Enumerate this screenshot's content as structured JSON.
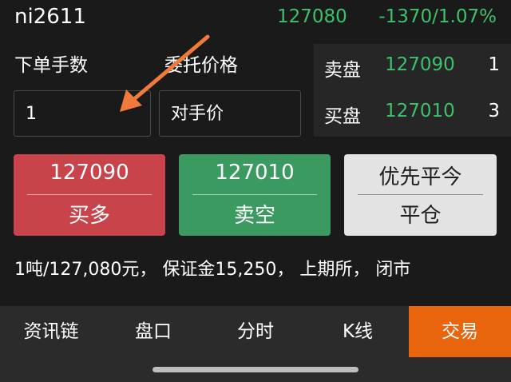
{
  "header": {
    "symbol": "ni2611",
    "last_price": "127080",
    "change": "-1370/1.07%"
  },
  "order_form": {
    "quantity_label": "下单手数",
    "quantity_value": "1",
    "price_label": "委托价格",
    "price_placeholder": "对手价"
  },
  "order_book": {
    "ask": {
      "label": "卖盘",
      "price": "127090",
      "qty": "1"
    },
    "bid": {
      "label": "买盘",
      "price": "127010",
      "qty": "3"
    }
  },
  "actions": {
    "buy_long": {
      "price": "127090",
      "label": "买多"
    },
    "sell_short": {
      "price": "127010",
      "label": "卖空"
    },
    "close": {
      "top": "优先平今",
      "label": "平仓"
    }
  },
  "info_line": "1吨/127,080元， 保证金15,250， 上期所， 闭市",
  "tabs": {
    "news": "资讯链",
    "book": "盘口",
    "timeshare": "分时",
    "kline": "K线",
    "trade": "交易"
  },
  "colors": {
    "up_green": "#3cc26a",
    "buy_red": "#c9434a",
    "sell_green": "#3a9a5f",
    "active_tab": "#e8650d",
    "annotation_arrow": "#f07a3a"
  }
}
